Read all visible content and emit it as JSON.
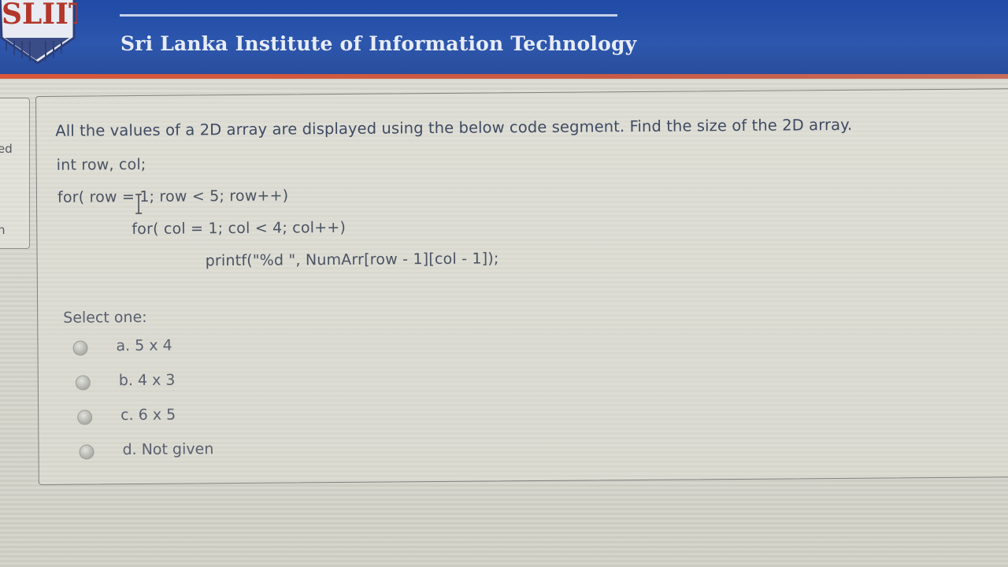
{
  "header": {
    "logo_text": "SLIIT",
    "institute_name": "Sri Lanka Institute of Information Technology",
    "colors": {
      "banner": "#2a52a8",
      "accent": "#d45a40"
    }
  },
  "nav_fragment": {
    "items": [
      "ed",
      "n"
    ]
  },
  "question": {
    "text": "All the values of a 2D array are displayed using the below code segment. Find the size of the 2D array.",
    "code": [
      "int row, col;",
      "for( row = 1; row < 5; row++)",
      "for( col = 1; col < 4; col++)",
      "printf(\"%d \", NumArr[row - 1][col - 1]);"
    ],
    "select_label": "Select one:",
    "options": [
      {
        "label": "a. 5 x 4",
        "selected": false
      },
      {
        "label": "b. 4 x 3",
        "selected": false
      },
      {
        "label": "c. 6 x 5",
        "selected": false
      },
      {
        "label": "d. Not given",
        "selected": false
      }
    ]
  }
}
